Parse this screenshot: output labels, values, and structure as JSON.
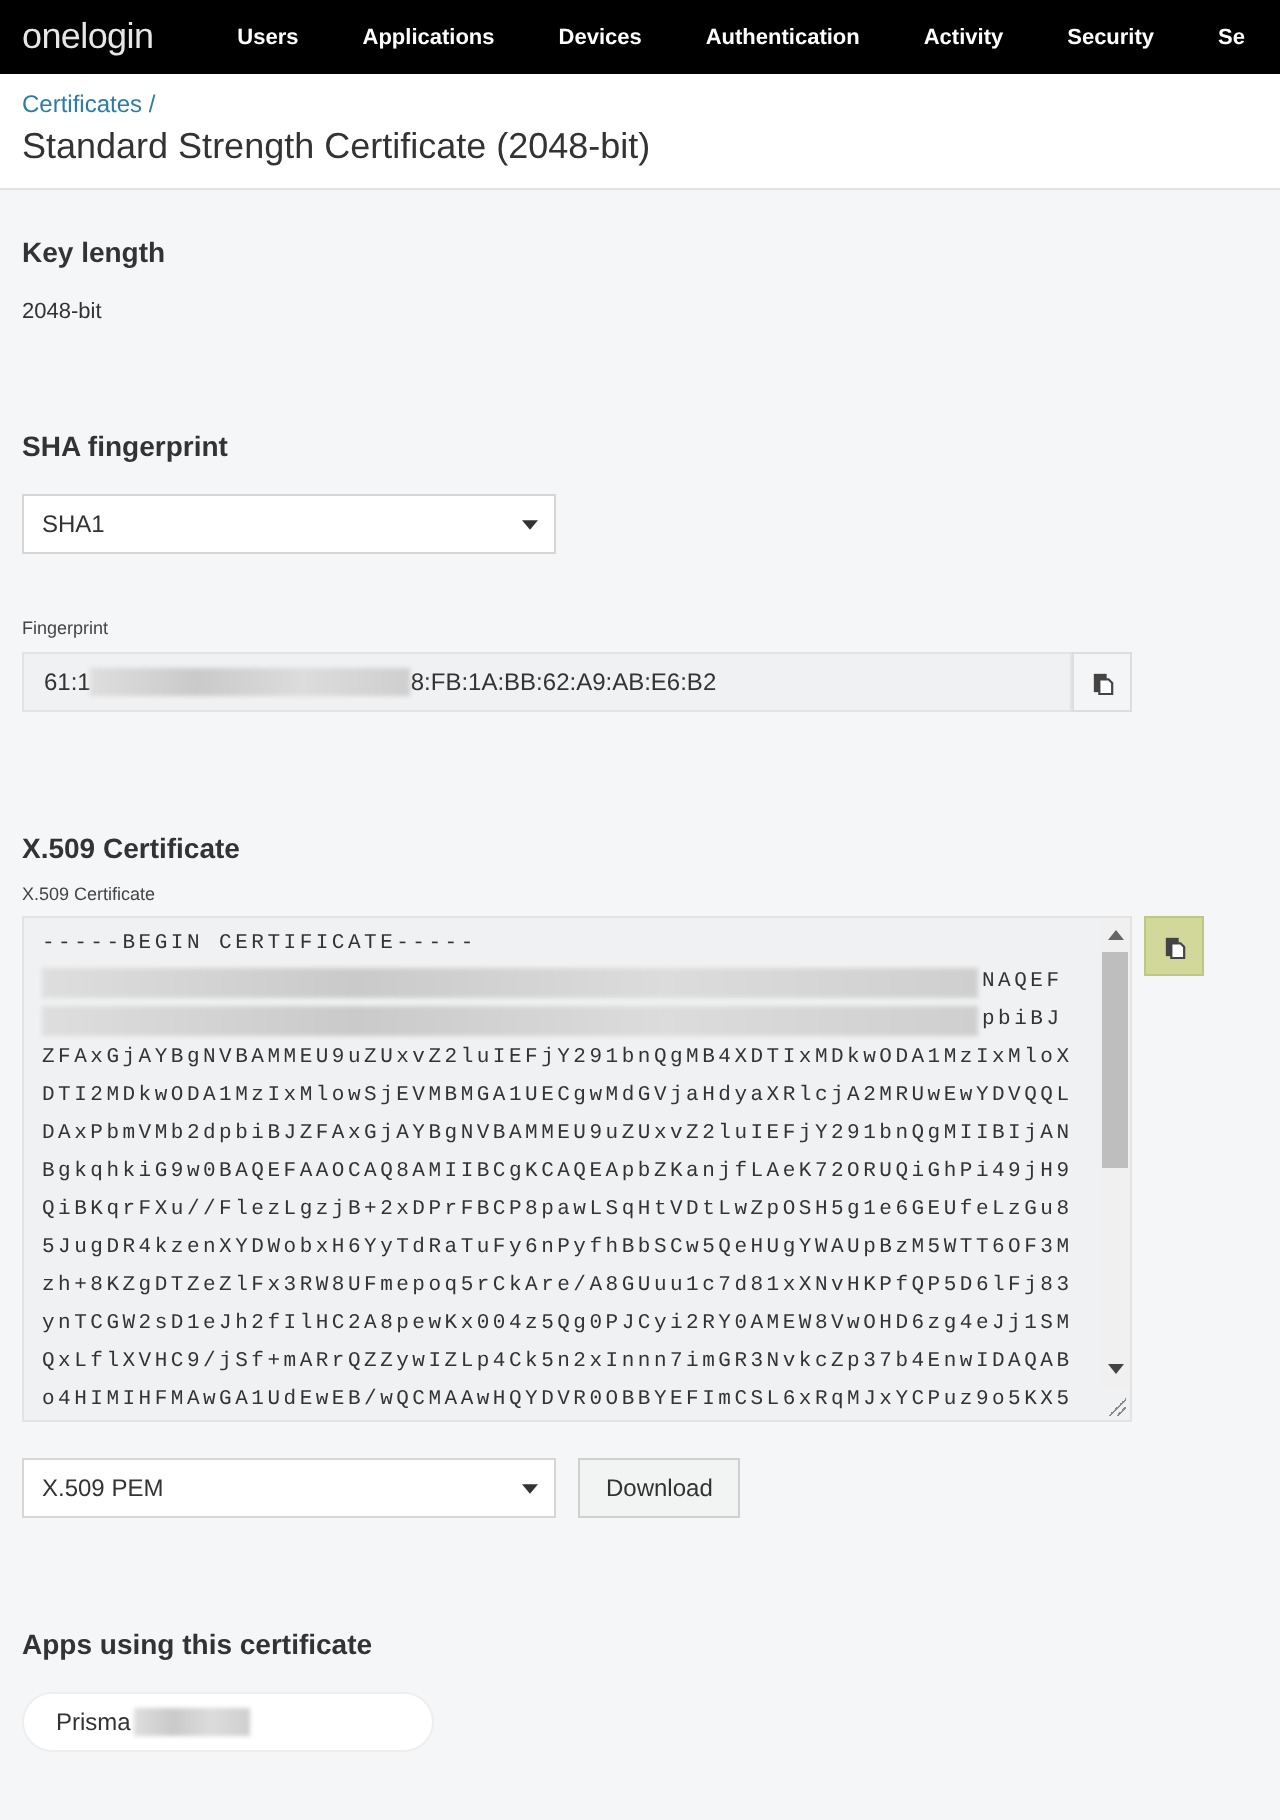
{
  "nav": {
    "logo": "onelogin",
    "items": [
      "Users",
      "Applications",
      "Devices",
      "Authentication",
      "Activity",
      "Security",
      "Se"
    ]
  },
  "header": {
    "breadcrumb": "Certificates /",
    "title": "Standard Strength Certificate (2048-bit)"
  },
  "key_length": {
    "heading": "Key length",
    "value": "2048-bit"
  },
  "sha": {
    "heading": "SHA fingerprint",
    "select": "SHA1",
    "field_label": "Fingerprint",
    "fingerprint_start": "61:1",
    "fingerprint_end": "8:FB:1A:BB:62:A9:AB:E6:B2",
    "copy_highlighted": false
  },
  "certificate": {
    "heading": "X.509 Certificate",
    "field_label": "X.509 Certificate",
    "copy_highlighted": true,
    "lines": [
      {
        "kind": "plain",
        "text": "-----BEGIN CERTIFICATE-----"
      },
      {
        "kind": "redacted",
        "end": "NAQEF"
      },
      {
        "kind": "redacted",
        "end": "pbiBJ"
      },
      {
        "kind": "plain",
        "text": "ZFAxGjAYBgNVBAMMEU9uZUxvZ2luIEFjY291bnQgMB4XDTIxMDkwODA1MzIxMloX"
      },
      {
        "kind": "plain",
        "text": "DTI2MDkwODA1MzIxMlowSjEVMBMGA1UECgwMdGVjaHdyaXRlcjA2MRUwEwYDVQQL"
      },
      {
        "kind": "plain",
        "text": "DAxPbmVMb2dpbiBJZFAxGjAYBgNVBAMMEU9uZUxvZ2luIEFjY291bnQgMIIBIjAN"
      },
      {
        "kind": "plain",
        "text": "BgkqhkiG9w0BAQEFAAOCAQ8AMIIBCgKCAQEApbZKanjfLAeK72ORUQiGhPi49jH9"
      },
      {
        "kind": "plain",
        "text": "QiBKqrFXu//FlezLgzjB+2xDPrFBCP8pawLSqHtVDtLwZpOSH5g1e6GEUfeLzGu8"
      },
      {
        "kind": "plain",
        "text": "5JugDR4kzenXYDWobxH6YyTdRaTuFy6nPyfhBbSCw5QeHUgYWAUpBzM5WTT6OF3M"
      },
      {
        "kind": "plain",
        "text": "zh+8KZgDTZeZlFx3RW8UFmepoq5rCkAre/A8GUuu1c7d81xXNvHKPfQP5D6lFj83"
      },
      {
        "kind": "plain",
        "text": "ynTCGW2sD1eJh2fIlHC2A8pewKx004z5Qg0PJCyi2RY0AMEW8VwOHD6zg4eJj1SM"
      },
      {
        "kind": "plain",
        "text": "QxLflXVHC9/jSf+mARrQZZywIZLp4Ck5n2xInnn7imGR3NvkcZp37b4EnwIDAQAB"
      },
      {
        "kind": "plain",
        "text": "o4HIMIHFMAwGA1UdEwEB/wQCMAAwHQYDVR0OBBYEFImCSL6xRqMJxYCPuz9o5KX5"
      }
    ],
    "format_select": "X.509 PEM",
    "download": "Download"
  },
  "apps": {
    "heading": "Apps using this certificate",
    "items": [
      {
        "name": "Prisma",
        "redacted": true
      }
    ]
  }
}
